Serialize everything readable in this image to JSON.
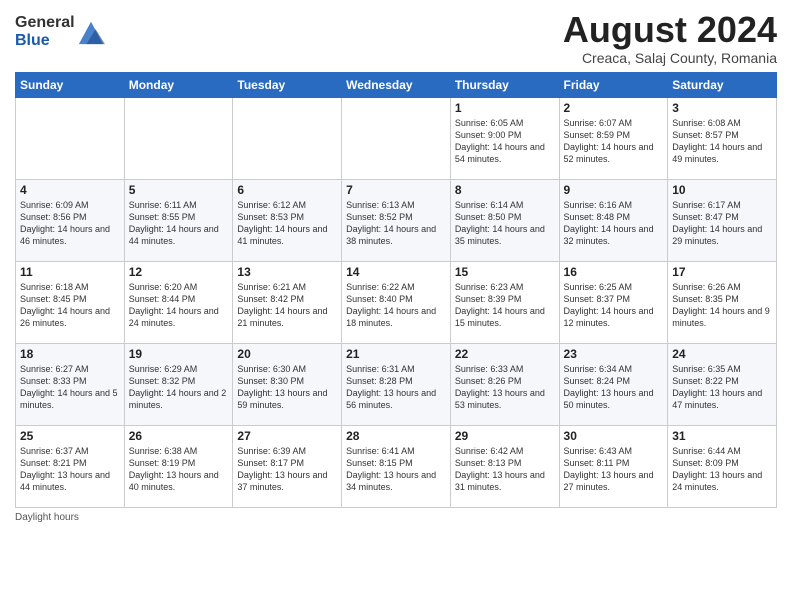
{
  "logo": {
    "general": "General",
    "blue": "Blue"
  },
  "title": "August 2024",
  "location": "Creaca, Salaj County, Romania",
  "footer": "Daylight hours",
  "weekdays": [
    "Sunday",
    "Monday",
    "Tuesday",
    "Wednesday",
    "Thursday",
    "Friday",
    "Saturday"
  ],
  "weeks": [
    [
      {
        "day": "",
        "content": ""
      },
      {
        "day": "",
        "content": ""
      },
      {
        "day": "",
        "content": ""
      },
      {
        "day": "",
        "content": ""
      },
      {
        "day": "1",
        "content": "Sunrise: 6:05 AM\nSunset: 9:00 PM\nDaylight: 14 hours\nand 54 minutes."
      },
      {
        "day": "2",
        "content": "Sunrise: 6:07 AM\nSunset: 8:59 PM\nDaylight: 14 hours\nand 52 minutes."
      },
      {
        "day": "3",
        "content": "Sunrise: 6:08 AM\nSunset: 8:57 PM\nDaylight: 14 hours\nand 49 minutes."
      }
    ],
    [
      {
        "day": "4",
        "content": "Sunrise: 6:09 AM\nSunset: 8:56 PM\nDaylight: 14 hours\nand 46 minutes."
      },
      {
        "day": "5",
        "content": "Sunrise: 6:11 AM\nSunset: 8:55 PM\nDaylight: 14 hours\nand 44 minutes."
      },
      {
        "day": "6",
        "content": "Sunrise: 6:12 AM\nSunset: 8:53 PM\nDaylight: 14 hours\nand 41 minutes."
      },
      {
        "day": "7",
        "content": "Sunrise: 6:13 AM\nSunset: 8:52 PM\nDaylight: 14 hours\nand 38 minutes."
      },
      {
        "day": "8",
        "content": "Sunrise: 6:14 AM\nSunset: 8:50 PM\nDaylight: 14 hours\nand 35 minutes."
      },
      {
        "day": "9",
        "content": "Sunrise: 6:16 AM\nSunset: 8:48 PM\nDaylight: 14 hours\nand 32 minutes."
      },
      {
        "day": "10",
        "content": "Sunrise: 6:17 AM\nSunset: 8:47 PM\nDaylight: 14 hours\nand 29 minutes."
      }
    ],
    [
      {
        "day": "11",
        "content": "Sunrise: 6:18 AM\nSunset: 8:45 PM\nDaylight: 14 hours\nand 26 minutes."
      },
      {
        "day": "12",
        "content": "Sunrise: 6:20 AM\nSunset: 8:44 PM\nDaylight: 14 hours\nand 24 minutes."
      },
      {
        "day": "13",
        "content": "Sunrise: 6:21 AM\nSunset: 8:42 PM\nDaylight: 14 hours\nand 21 minutes."
      },
      {
        "day": "14",
        "content": "Sunrise: 6:22 AM\nSunset: 8:40 PM\nDaylight: 14 hours\nand 18 minutes."
      },
      {
        "day": "15",
        "content": "Sunrise: 6:23 AM\nSunset: 8:39 PM\nDaylight: 14 hours\nand 15 minutes."
      },
      {
        "day": "16",
        "content": "Sunrise: 6:25 AM\nSunset: 8:37 PM\nDaylight: 14 hours\nand 12 minutes."
      },
      {
        "day": "17",
        "content": "Sunrise: 6:26 AM\nSunset: 8:35 PM\nDaylight: 14 hours\nand 9 minutes."
      }
    ],
    [
      {
        "day": "18",
        "content": "Sunrise: 6:27 AM\nSunset: 8:33 PM\nDaylight: 14 hours\nand 5 minutes."
      },
      {
        "day": "19",
        "content": "Sunrise: 6:29 AM\nSunset: 8:32 PM\nDaylight: 14 hours\nand 2 minutes."
      },
      {
        "day": "20",
        "content": "Sunrise: 6:30 AM\nSunset: 8:30 PM\nDaylight: 13 hours\nand 59 minutes."
      },
      {
        "day": "21",
        "content": "Sunrise: 6:31 AM\nSunset: 8:28 PM\nDaylight: 13 hours\nand 56 minutes."
      },
      {
        "day": "22",
        "content": "Sunrise: 6:33 AM\nSunset: 8:26 PM\nDaylight: 13 hours\nand 53 minutes."
      },
      {
        "day": "23",
        "content": "Sunrise: 6:34 AM\nSunset: 8:24 PM\nDaylight: 13 hours\nand 50 minutes."
      },
      {
        "day": "24",
        "content": "Sunrise: 6:35 AM\nSunset: 8:22 PM\nDaylight: 13 hours\nand 47 minutes."
      }
    ],
    [
      {
        "day": "25",
        "content": "Sunrise: 6:37 AM\nSunset: 8:21 PM\nDaylight: 13 hours\nand 44 minutes."
      },
      {
        "day": "26",
        "content": "Sunrise: 6:38 AM\nSunset: 8:19 PM\nDaylight: 13 hours\nand 40 minutes."
      },
      {
        "day": "27",
        "content": "Sunrise: 6:39 AM\nSunset: 8:17 PM\nDaylight: 13 hours\nand 37 minutes."
      },
      {
        "day": "28",
        "content": "Sunrise: 6:41 AM\nSunset: 8:15 PM\nDaylight: 13 hours\nand 34 minutes."
      },
      {
        "day": "29",
        "content": "Sunrise: 6:42 AM\nSunset: 8:13 PM\nDaylight: 13 hours\nand 31 minutes."
      },
      {
        "day": "30",
        "content": "Sunrise: 6:43 AM\nSunset: 8:11 PM\nDaylight: 13 hours\nand 27 minutes."
      },
      {
        "day": "31",
        "content": "Sunrise: 6:44 AM\nSunset: 8:09 PM\nDaylight: 13 hours\nand 24 minutes."
      }
    ]
  ]
}
